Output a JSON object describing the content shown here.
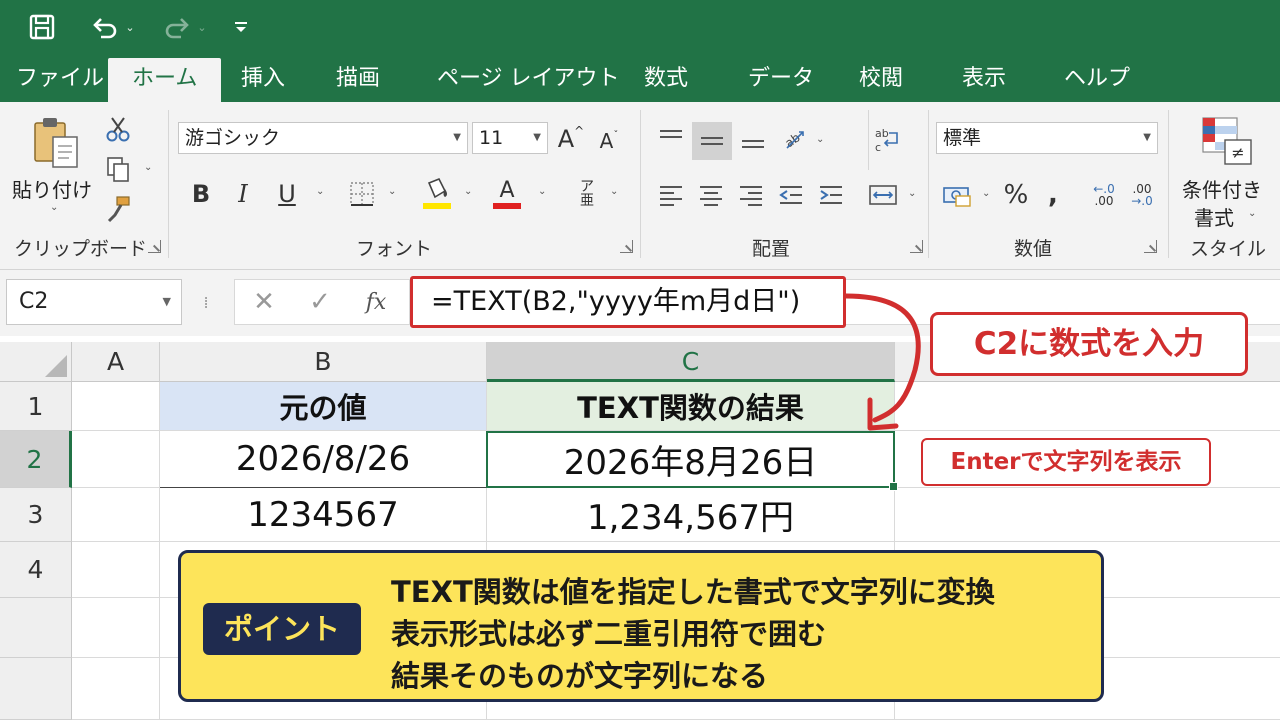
{
  "qat": {
    "save_icon": "save-icon",
    "undo_icon": "undo-icon",
    "redo_icon": "redo-icon",
    "customize_icon": "customize-qat-icon"
  },
  "tabs": [
    "ファイル",
    "ホーム",
    "挿入",
    "描画",
    "ページ レイアウト",
    "数式",
    "データ",
    "校閲",
    "表示",
    "ヘルプ"
  ],
  "active_tab": "ホーム",
  "ribbon": {
    "clipboard": {
      "paste_label": "貼り付け",
      "group_label": "クリップボード"
    },
    "font": {
      "font_name": "游ゴシック",
      "font_size": "11",
      "group_label": "フォント"
    },
    "alignment": {
      "group_label": "配置"
    },
    "number": {
      "format": "標準",
      "group_label": "数値"
    },
    "styles": {
      "cond_format_line1": "条件付き",
      "cond_format_line2": "書式",
      "group_label": "スタイル"
    }
  },
  "formula_bar": {
    "name_box": "C2",
    "fx": "fx",
    "formula": "=TEXT(B2,\"yyyy年m月d日\")"
  },
  "grid": {
    "columns": [
      "A",
      "B",
      "C"
    ],
    "rows": [
      "1",
      "2",
      "3",
      "4"
    ],
    "cells": {
      "B1": "元の値",
      "C1": "TEXT関数の結果",
      "B2": "2026/8/26",
      "C2": "2026年8月26日",
      "B3": "1234567",
      "C3": "1,234,567円"
    },
    "active_cell": "C2"
  },
  "callouts": {
    "input": "C2に数式を入力",
    "enter": "Enterで文字列を表示"
  },
  "point": {
    "badge": "ポイント",
    "lines": [
      "TEXT関数は値を指定した書式で文字列に変換",
      "表示形式は必ず二重引用符で囲む",
      "結果そのものが文字列になる"
    ]
  },
  "colors": {
    "excel_green": "#217346",
    "callout_red": "#d12e2e",
    "point_yellow": "#fde45a",
    "point_navy": "#1f2b4f",
    "header_b_fill": "#d9e4f5",
    "header_c_fill": "#e3efe0"
  }
}
